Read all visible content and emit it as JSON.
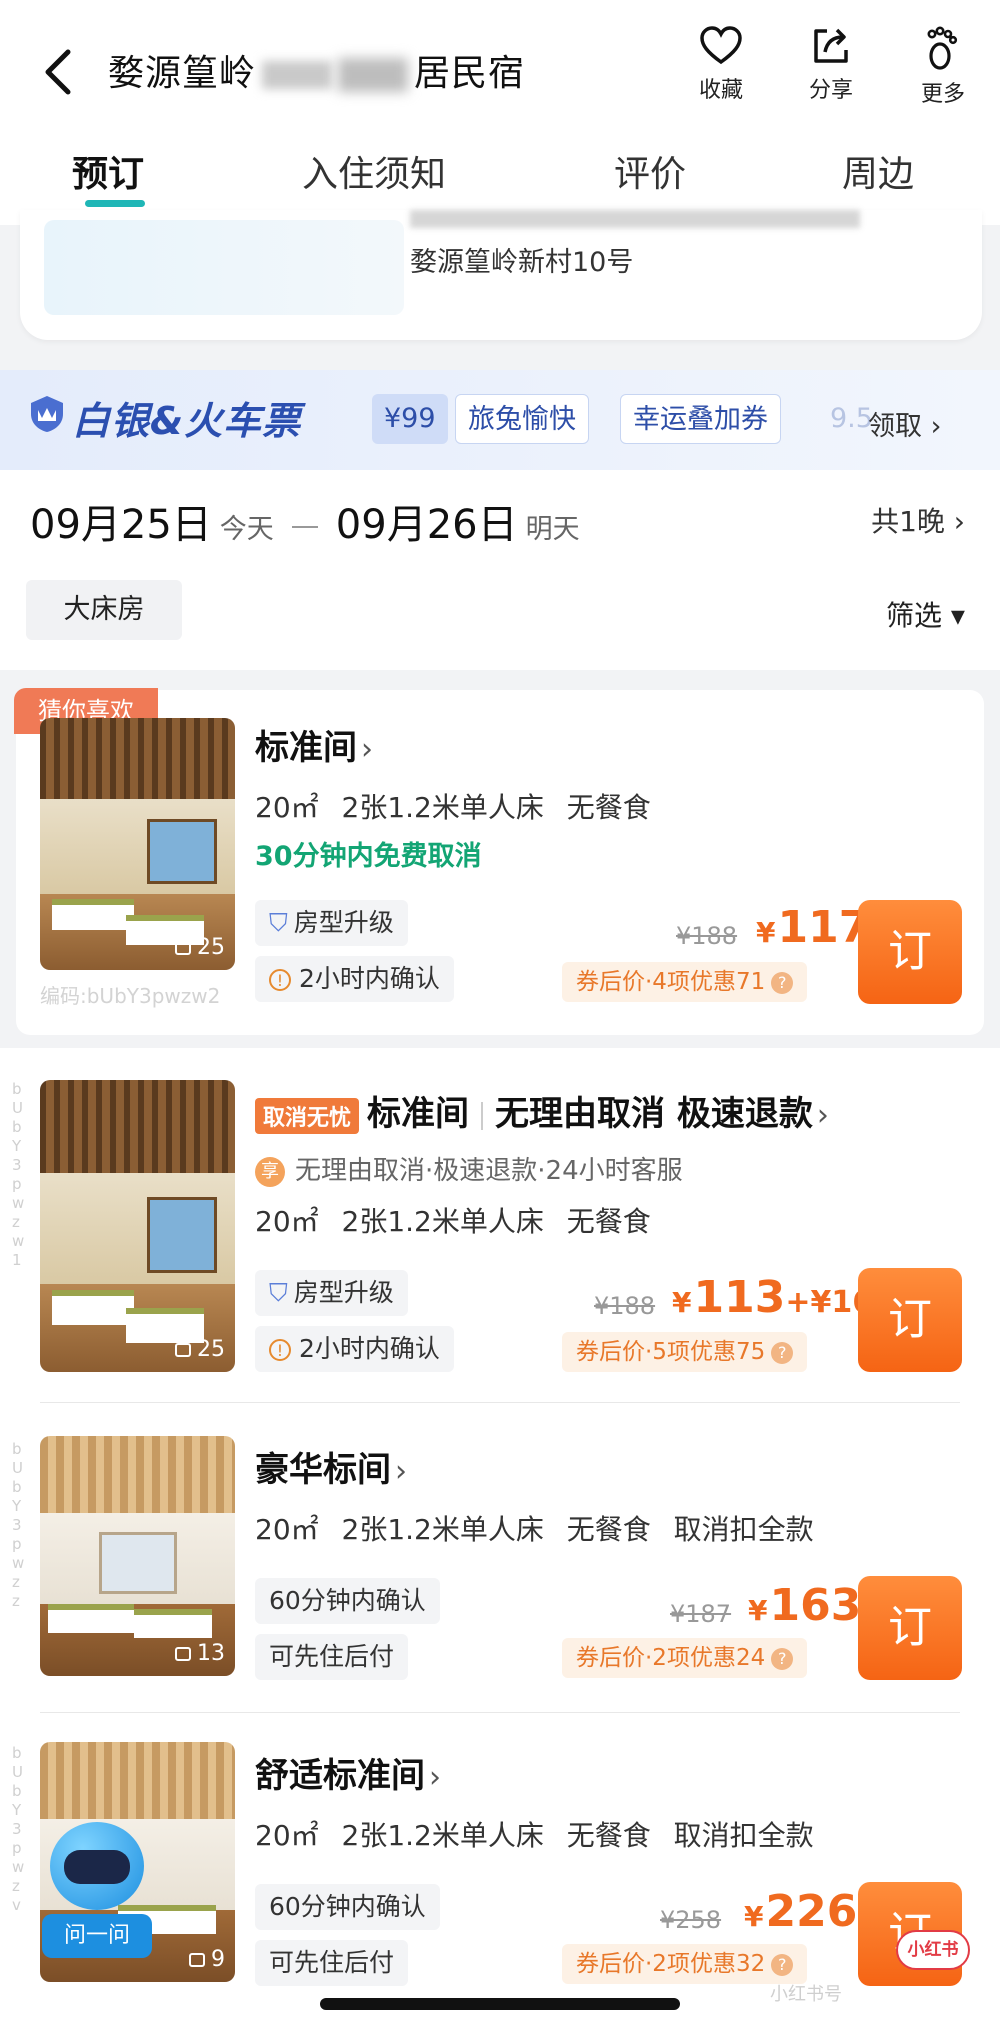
{
  "header": {
    "title_prefix": "婺源篁岭",
    "title_suffix": "居民宿",
    "actions": [
      {
        "icon": "heart-icon",
        "label": "收藏"
      },
      {
        "icon": "share-icon",
        "label": "分享"
      },
      {
        "icon": "footprint-icon",
        "label": "更多"
      }
    ]
  },
  "tabs": [
    "预订",
    "入住须知",
    "评价",
    "周边"
  ],
  "address": {
    "text": "婺源篁岭新村10号"
  },
  "promo": {
    "title": "白银&火车票",
    "chips": [
      "¥99",
      "旅兔愉快",
      "幸运叠加券"
    ],
    "faded": "9.5",
    "claim": "领取 ›"
  },
  "dates": {
    "checkin": "09月25日",
    "checkin_sub": "今天",
    "checkout": "09月26日",
    "checkout_sub": "明天",
    "nights": "共1晚 ›"
  },
  "filters": {
    "bed_chip": "大床房",
    "filter_label": "筛选 ▾"
  },
  "rooms": [
    {
      "tag": "猜你喜欢",
      "name": "标准间",
      "spec": "20㎡ 2张1.2米单人床 无餐食",
      "free_cancel": "30分钟内免费取消",
      "badge1": "房型升级",
      "badge2": "2小时内确认",
      "photos": "25",
      "code": "编码:bUbY3pwzw2",
      "old_price": "¥188",
      "price": "117",
      "coupon": "券后价·4项优惠71",
      "book": "订"
    },
    {
      "cancel_tag": "取消无忧",
      "name": "标准间",
      "name_extra": "无理由取消 极速退款",
      "service": "无理由取消·极速退款·24小时客服",
      "service_icon": "享",
      "spec": "20㎡ 2张1.2米单人床 无餐食",
      "badge1": "房型升级",
      "badge2": "2小时内确认",
      "photos": "25",
      "side_code": "bUbY3pwzw1",
      "old_price": "¥188",
      "price": "113",
      "price_extra": "+¥16",
      "coupon": "券后价·5项优惠75",
      "book": "订"
    },
    {
      "name": "豪华标间",
      "spec": "20㎡ 2张1.2米单人床 无餐食 取消扣全款",
      "badge1": "60分钟内确认",
      "badge2": "可先住后付",
      "photos": "13",
      "side_code": "bUbY3pwzz",
      "old_price": "¥187",
      "price": "163",
      "coupon": "券后价·2项优惠24",
      "book": "订"
    },
    {
      "name": "舒适标准间",
      "spec": "20㎡ 2张1.2米单人床 无餐食 取消扣全款",
      "badge1": "60分钟内确认",
      "badge2": "可先住后付",
      "photos": "9",
      "side_code": "bUbY3pwzv",
      "old_price": "¥258",
      "price": "226",
      "coupon": "券后价·2项优惠32",
      "book": "订"
    }
  ],
  "assistant": {
    "label": "问一问"
  },
  "watermark": {
    "app": "小红书",
    "text": "小红书号"
  }
}
